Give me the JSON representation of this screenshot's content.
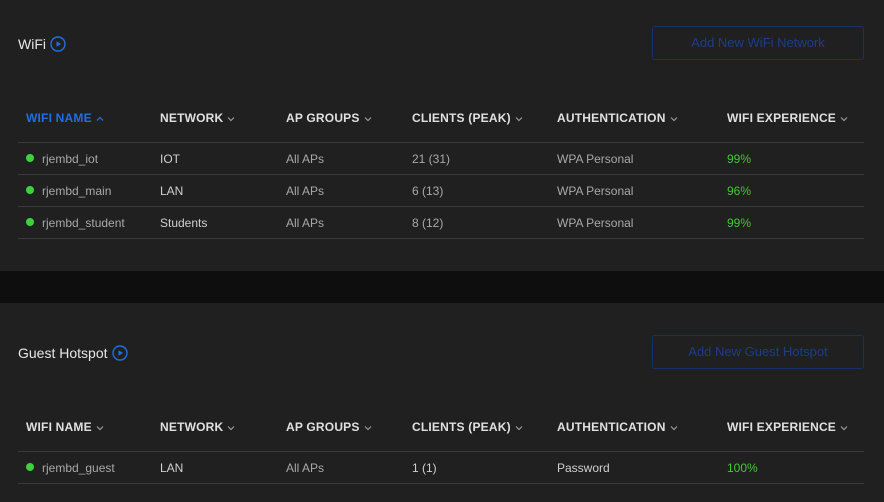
{
  "wifi": {
    "title": "WiFi",
    "add_button": "Add New WiFi Network",
    "columns": [
      "WIFI NAME",
      "NETWORK",
      "AP GROUPS",
      "CLIENTS (PEAK)",
      "AUTHENTICATION",
      "WIFI EXPERIENCE"
    ],
    "sort_column": "WIFI NAME",
    "sort_direction": "asc",
    "rows": [
      {
        "name": "rjembd_iot",
        "network": "IOT",
        "ap_groups": "All APs",
        "clients": "21 (31)",
        "auth": "WPA Personal",
        "experience": "99%",
        "status": "online"
      },
      {
        "name": "rjembd_main",
        "network": "LAN",
        "ap_groups": "All APs",
        "clients": "6 (13)",
        "auth": "WPA Personal",
        "experience": "96%",
        "status": "online"
      },
      {
        "name": "rjembd_student",
        "network": "Students",
        "ap_groups": "All APs",
        "clients": "8 (12)",
        "auth": "WPA Personal",
        "experience": "99%",
        "status": "online"
      }
    ]
  },
  "guest": {
    "title": "Guest Hotspot",
    "add_button": "Add New Guest Hotspot",
    "columns": [
      "WIFI NAME",
      "NETWORK",
      "AP GROUPS",
      "CLIENTS (PEAK)",
      "AUTHENTICATION",
      "WIFI EXPERIENCE"
    ],
    "rows": [
      {
        "name": "rjembd_guest",
        "network": "LAN",
        "ap_groups": "All APs",
        "clients": "1 (1)",
        "auth": "Password",
        "experience": "100%",
        "status": "online"
      }
    ]
  },
  "colors": {
    "accent": "#1e6fe6",
    "online_dot": "#3fcf3f",
    "experience_good": "#41c932",
    "button_border": "#15306b"
  },
  "icons": {
    "title_icon": "play-circle-icon",
    "sort_asc": "chevron-up-icon",
    "sort_none": "chevron-down-icon",
    "status": "status-dot-icon"
  }
}
